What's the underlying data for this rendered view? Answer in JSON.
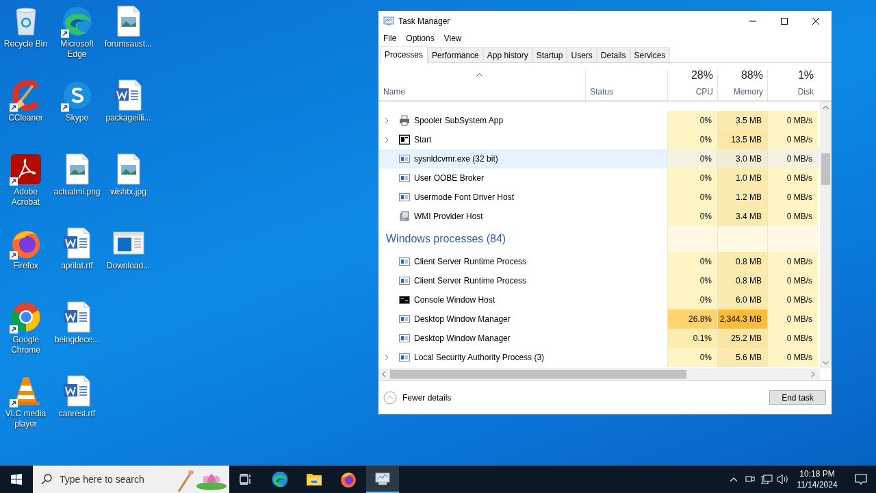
{
  "desktop": {
    "columns": [
      [
        {
          "label": "Recycle Bin",
          "shortcut": false
        },
        {
          "label": "CCleaner",
          "shortcut": true
        },
        {
          "label": "Adobe Acrobat",
          "shortcut": true
        },
        {
          "label": "Firefox",
          "shortcut": true
        },
        {
          "label": "Google Chrome",
          "shortcut": true
        },
        {
          "label": "VLC media player",
          "shortcut": true
        }
      ],
      [
        {
          "label": "Microsoft Edge",
          "shortcut": true
        },
        {
          "label": "Skype",
          "shortcut": true
        },
        {
          "label": "actualmi.png",
          "shortcut": false
        },
        {
          "label": "aprilat.rtf",
          "shortcut": false
        },
        {
          "label": "beingdece...",
          "shortcut": false
        },
        {
          "label": "canrest.rtf",
          "shortcut": false
        }
      ],
      [
        {
          "label": "forumsaust...",
          "shortcut": false
        },
        {
          "label": "packageilli...",
          "shortcut": false
        },
        {
          "label": "wishtx.jpg",
          "shortcut": false
        },
        {
          "label": "Download...",
          "shortcut": false
        }
      ]
    ]
  },
  "window": {
    "title": "Task Manager",
    "menu": [
      "File",
      "Options",
      "View"
    ],
    "tabs": [
      {
        "label": "Processes",
        "selected": true
      },
      {
        "label": "Performance",
        "selected": false
      },
      {
        "label": "App history",
        "selected": false
      },
      {
        "label": "Startup",
        "selected": false
      },
      {
        "label": "Users",
        "selected": false
      },
      {
        "label": "Details",
        "selected": false
      },
      {
        "label": "Services",
        "selected": false
      }
    ],
    "columns": [
      {
        "label": "Name"
      },
      {
        "label": "Status"
      },
      {
        "total": "28%",
        "label": "CPU"
      },
      {
        "total": "88%",
        "label": "Memory"
      },
      {
        "total": "1%",
        "label": "Disk"
      }
    ],
    "rows": [
      {
        "kind": "process",
        "name": "Spooler SubSystem App",
        "expandable": true,
        "selected": false,
        "cpu": {
          "text": "0%",
          "color": "#fff4c4"
        },
        "memory": {
          "text": "3.5 MB",
          "color": "#fbeab0"
        },
        "disk": {
          "text": "0 MB/s",
          "color": "#fff4c4"
        }
      },
      {
        "kind": "process",
        "name": "Start",
        "expandable": true,
        "selected": false,
        "cpu": {
          "text": "0%",
          "color": "#fff4c4"
        },
        "memory": {
          "text": "13.5 MB",
          "color": "#fae7a6"
        },
        "disk": {
          "text": "0 MB/s",
          "color": "#fff4c4"
        }
      },
      {
        "kind": "process",
        "name": "sysnldcvmr.exe (32 bit)",
        "expandable": false,
        "selected": true,
        "cpu": {
          "text": "0%",
          "color": "#f3f1e2"
        },
        "memory": {
          "text": "3.0 MB",
          "color": "#f1ecd4"
        },
        "disk": {
          "text": "0 MB/s",
          "color": "#f3f1e2"
        }
      },
      {
        "kind": "process",
        "name": "User OOBE Broker",
        "expandable": false,
        "selected": false,
        "cpu": {
          "text": "0%",
          "color": "#fff4c4"
        },
        "memory": {
          "text": "1.0 MB",
          "color": "#fbeab0"
        },
        "disk": {
          "text": "0 MB/s",
          "color": "#fff4c4"
        }
      },
      {
        "kind": "process",
        "name": "Usermode Font Driver Host",
        "expandable": false,
        "selected": false,
        "cpu": {
          "text": "0%",
          "color": "#fff4c4"
        },
        "memory": {
          "text": "1.2 MB",
          "color": "#fbeab0"
        },
        "disk": {
          "text": "0 MB/s",
          "color": "#fff4c4"
        }
      },
      {
        "kind": "process",
        "name": "WMI Provider Host",
        "expandable": false,
        "selected": false,
        "cpu": {
          "text": "0%",
          "color": "#fff4c4"
        },
        "memory": {
          "text": "3.4 MB",
          "color": "#fbeab0"
        },
        "disk": {
          "text": "0 MB/s",
          "color": "#fff4c4"
        }
      },
      {
        "kind": "group",
        "name": "Windows processes (84)"
      },
      {
        "kind": "process",
        "name": "Client Server Runtime Process",
        "expandable": false,
        "selected": false,
        "cpu": {
          "text": "0%",
          "color": "#fff4c4"
        },
        "memory": {
          "text": "0.8 MB",
          "color": "#fbeab0"
        },
        "disk": {
          "text": "0 MB/s",
          "color": "#fff4c4"
        }
      },
      {
        "kind": "process",
        "name": "Client Server Runtime Process",
        "expandable": false,
        "selected": false,
        "cpu": {
          "text": "0%",
          "color": "#fff4c4"
        },
        "memory": {
          "text": "0.8 MB",
          "color": "#fbeab0"
        },
        "disk": {
          "text": "0 MB/s",
          "color": "#fff4c4"
        }
      },
      {
        "kind": "process",
        "name": "Console Window Host",
        "expandable": false,
        "selected": false,
        "cpu": {
          "text": "0%",
          "color": "#fff4c4"
        },
        "memory": {
          "text": "6.0 MB",
          "color": "#fbeab0"
        },
        "disk": {
          "text": "0 MB/s",
          "color": "#fff4c4"
        }
      },
      {
        "kind": "process",
        "name": "Desktop Window Manager",
        "expandable": false,
        "selected": false,
        "cpu": {
          "text": "26.8%",
          "color": "#ffd46e"
        },
        "memory": {
          "text": "2,344.3 MB",
          "color": "#fbbc3a"
        },
        "disk": {
          "text": "0 MB/s",
          "color": "#fff4c4"
        }
      },
      {
        "kind": "process",
        "name": "Desktop Window Manager",
        "expandable": false,
        "selected": false,
        "cpu": {
          "text": "0.1%",
          "color": "#fcecae"
        },
        "memory": {
          "text": "25.2 MB",
          "color": "#fae6a2"
        },
        "disk": {
          "text": "0 MB/s",
          "color": "#fff4c4"
        }
      },
      {
        "kind": "process",
        "name": "Local Security Authority Process (3)",
        "expandable": true,
        "selected": false,
        "cpu": {
          "text": "0%",
          "color": "#fff4c4"
        },
        "memory": {
          "text": "5.6 MB",
          "color": "#fbeab0"
        },
        "disk": {
          "text": "0 MB/s",
          "color": "#fff4c4"
        }
      }
    ],
    "footer": {
      "toggle": "Fewer details",
      "button": "End task"
    }
  },
  "taskbar": {
    "search": {
      "placeholder": "Type here to search"
    },
    "time": "10:18 PM",
    "date": "11/14/2024"
  }
}
